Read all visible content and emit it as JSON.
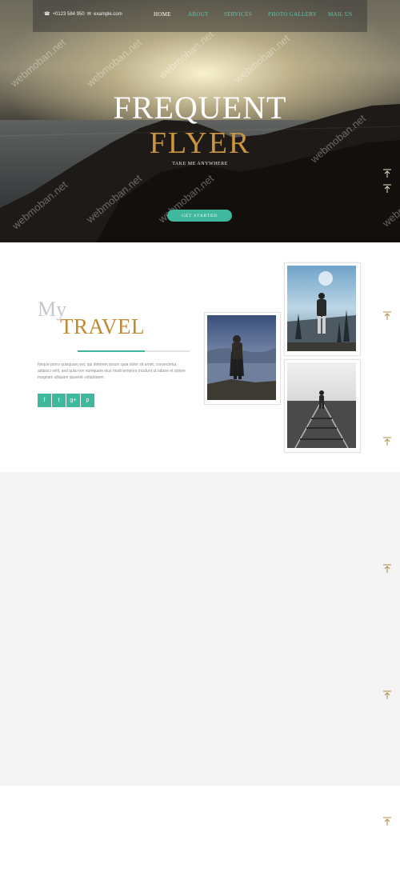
{
  "topbar": {
    "phone": "+0123 584 950",
    "email": "example.com",
    "nav": [
      {
        "label": "HOME",
        "active": true
      },
      {
        "label": "ABOUT",
        "active": false
      },
      {
        "label": "SERVICES",
        "active": false
      },
      {
        "label": "PHOTO GALLERY",
        "active": false
      },
      {
        "label": "MAIL US",
        "active": false
      }
    ]
  },
  "hero": {
    "title_line1": "FREQUENT",
    "title_line2": "FLYER",
    "tagline": "TAKE ME ANYWHERE",
    "cta_label": "GET STARTED"
  },
  "about": {
    "heading_small": "My",
    "heading_large": "TRAVEL",
    "progress": 0.6,
    "paragraph": "Neque porro quisquam est, qui dolorem ipsum quia dolor sit amet, consectetur, adipisci velit, sed quia non numquam eius modi tempora incidunt ut labore et dolore magnam aliquam quaerat voluptatem.",
    "social": [
      {
        "icon": "facebook-icon",
        "glyph": "f"
      },
      {
        "icon": "twitter-icon",
        "glyph": "t"
      },
      {
        "icon": "google-plus-icon",
        "glyph": "g+"
      },
      {
        "icon": "pinterest-icon",
        "glyph": "p"
      }
    ]
  },
  "watermark": "webmoban.net",
  "colors": {
    "accent": "#3fb89e",
    "gold": "#c08a35",
    "nav_link": "#5ec9b2"
  }
}
